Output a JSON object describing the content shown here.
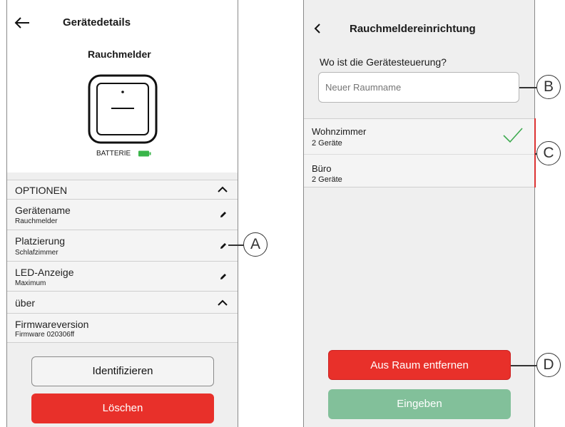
{
  "left_screen": {
    "header_title": "Gerätedetails",
    "device_name": "Rauchmelder",
    "battery_label": "BATTERIE",
    "options_header": "OPTIONEN",
    "options": [
      {
        "label": "Gerätename",
        "value": "Rauchmelder"
      },
      {
        "label": "Platzierung",
        "value": "Schlafzimmer"
      },
      {
        "label": "LED-Anzeige",
        "value": "Maximum"
      }
    ],
    "about_header": "über",
    "firmware": {
      "label": "Firmwareversion",
      "value": "Firmware 020306ff"
    },
    "identify_button": "Identifizieren",
    "delete_button": "Löschen"
  },
  "right_screen": {
    "header_title": "Rauchmeldereinrichtung",
    "question": "Wo ist die Gerätesteuerung?",
    "room_input_placeholder": "Neuer Raumname",
    "rooms": [
      {
        "name": "Wohnzimmer",
        "count": "2 Geräte",
        "selected": true
      },
      {
        "name": "Büro",
        "count": "2 Geräte",
        "selected": false
      }
    ],
    "remove_button": "Aus Raum entfernen",
    "enter_button": "Eingeben"
  },
  "callouts": {
    "a": "A",
    "b": "B",
    "c": "C",
    "d": "D"
  },
  "colors": {
    "red": "#e8302a",
    "green_button": "#82c09a",
    "check_green": "#3daa4f",
    "battery_green": "#3ab54a"
  }
}
